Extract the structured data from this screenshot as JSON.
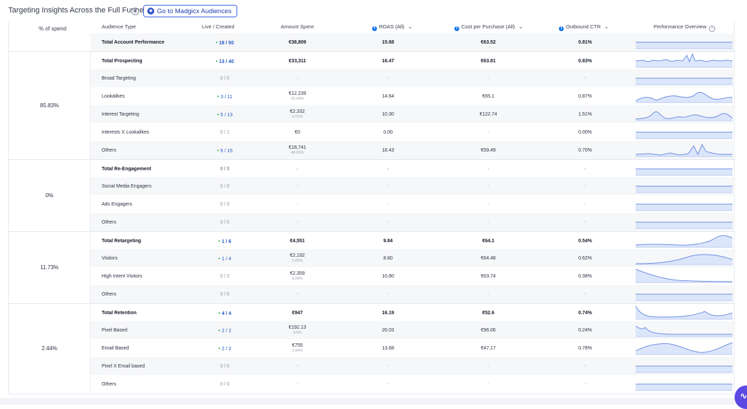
{
  "header": {
    "title": "Targeting Insights Across the Full Funnel",
    "info_icon": "info-icon",
    "audiences_button": "Go to Madgicx Audiences"
  },
  "columns": {
    "spend": "% of spend",
    "audience": "Audience Type",
    "live": "Live / Created",
    "amount": "Amount Spent",
    "roas": "ROAS (All)",
    "cpp": "Cost per Purchase (All)",
    "ctr": "Outbound CTR",
    "perf": "Performance Overview"
  },
  "colors": {
    "accent": "#1f56c8",
    "green_dot": "#2cb764",
    "spark": "#6d8fe0",
    "spark_fill": "#dce6fb"
  },
  "groups": [
    {
      "label": "85.83%"
    },
    {
      "label": "0%"
    },
    {
      "label": "11.73%"
    },
    {
      "label": "2.44%"
    }
  ],
  "rows": [
    {
      "name": "Total Account Performance",
      "live": "18 / 50",
      "amount": "€38,809",
      "amount_sub": "",
      "roas": "15.68",
      "cpp": "€63.52",
      "ctr": "0.81%",
      "bold": true,
      "dot": true,
      "spark": "flat"
    },
    {
      "name": "Total Prospecting",
      "live": "13 / 40",
      "amount": "€33,311",
      "amount_sub": "",
      "roas": "16.47",
      "cpp": "€63.81",
      "ctr": "0.83%",
      "bold": true,
      "dot": true,
      "spark": "spiky"
    },
    {
      "name": "Broad Targeting",
      "live": "0 / 0",
      "amount": "-",
      "amount_sub": "",
      "roas": "-",
      "cpp": "-",
      "ctr": "-",
      "bold": false,
      "dot": false,
      "spark": "flat"
    },
    {
      "name": "Lookalikes",
      "live": "3 / 11",
      "amount": "€12,239",
      "amount_sub": "31.54%",
      "roas": "14.64",
      "cpp": "€65.1",
      "ctr": "0.87%",
      "bold": false,
      "dot": true,
      "spark": "hills"
    },
    {
      "name": "Interest Targeting",
      "live": "5 / 13",
      "amount": "€2,332",
      "amount_sub": "6.01%",
      "roas": "10.30",
      "cpp": "€122.74",
      "ctr": "1.51%",
      "bold": false,
      "dot": true,
      "spark": "waves"
    },
    {
      "name": "Interests X Lookalikes",
      "live": "0 / 1",
      "amount": "€0",
      "amount_sub": "",
      "roas": "0.00",
      "cpp": "-",
      "ctr": "0.00%",
      "bold": false,
      "dot": false,
      "spark": "flat"
    },
    {
      "name": "Others",
      "live": "5 / 15",
      "amount": "€18,741",
      "amount_sub": "48.29%",
      "roas": "18.43",
      "cpp": "€59.49",
      "ctr": "0.70%",
      "bold": false,
      "dot": true,
      "spark": "spiky2"
    },
    {
      "name": "Total Re-Engagement",
      "live": "0 / 0",
      "amount": "-",
      "amount_sub": "",
      "roas": "-",
      "cpp": "-",
      "ctr": "-",
      "bold": true,
      "dot": false,
      "spark": "flat"
    },
    {
      "name": "Social Media Engagers",
      "live": "0 / 0",
      "amount": "-",
      "amount_sub": "",
      "roas": "-",
      "cpp": "-",
      "ctr": "-",
      "bold": false,
      "dot": false,
      "spark": "flat"
    },
    {
      "name": "Ads Engagers",
      "live": "0 / 0",
      "amount": "-",
      "amount_sub": "",
      "roas": "-",
      "cpp": "-",
      "ctr": "-",
      "bold": false,
      "dot": false,
      "spark": "flat"
    },
    {
      "name": "Others",
      "live": "0 / 0",
      "amount": "-",
      "amount_sub": "",
      "roas": "-",
      "cpp": "-",
      "ctr": "-",
      "bold": false,
      "dot": false,
      "spark": "flat"
    },
    {
      "name": "Total Retargeting",
      "live": "1 / 6",
      "amount": "€4,551",
      "amount_sub": "",
      "roas": "9.84",
      "cpp": "€64.1",
      "ctr": "0.54%",
      "bold": true,
      "dot": true,
      "spark": "rise"
    },
    {
      "name": "Visitors",
      "live": "1 / 4",
      "amount": "€2,192",
      "amount_sub": "5.65%",
      "roas": "8.80",
      "cpp": "€64.48",
      "ctr": "0.62%",
      "bold": false,
      "dot": true,
      "spark": "bump"
    },
    {
      "name": "High Intent Visitors",
      "live": "0 / 2",
      "amount": "€2,359",
      "amount_sub": "6.08%",
      "roas": "10.80",
      "cpp": "€63.74",
      "ctr": "0.38%",
      "bold": false,
      "dot": false,
      "spark": "fall"
    },
    {
      "name": "Others",
      "live": "0 / 0",
      "amount": "-",
      "amount_sub": "",
      "roas": "-",
      "cpp": "-",
      "ctr": "-",
      "bold": false,
      "dot": false,
      "spark": "flat"
    },
    {
      "name": "Total Retention",
      "live": "4 / 4",
      "amount": "€947",
      "amount_sub": "",
      "roas": "16.19",
      "cpp": "€52.6",
      "ctr": "0.74%",
      "bold": true,
      "dot": true,
      "spark": "dip"
    },
    {
      "name": "Pixel Based",
      "live": "2 / 2",
      "amount": "€192.13",
      "amount_sub": "0.5%",
      "roas": "26.03",
      "cpp": "€96.06",
      "ctr": "0.24%",
      "bold": false,
      "dot": true,
      "spark": "dropflat"
    },
    {
      "name": "Email Based",
      "live": "2 / 2",
      "amount": "€755",
      "amount_sub": "1.94%",
      "roas": "13.68",
      "cpp": "€47.17",
      "ctr": "0.78%",
      "bold": false,
      "dot": true,
      "spark": "swell"
    },
    {
      "name": "Pixel X Email based",
      "live": "0 / 0",
      "amount": "-",
      "amount_sub": "",
      "roas": "-",
      "cpp": "-",
      "ctr": "-",
      "bold": false,
      "dot": false,
      "spark": "flat"
    },
    {
      "name": "Others",
      "live": "0 / 0",
      "amount": "-",
      "amount_sub": "",
      "roas": "-",
      "cpp": "-",
      "ctr": "-",
      "bold": false,
      "dot": false,
      "spark": "flat"
    }
  ]
}
